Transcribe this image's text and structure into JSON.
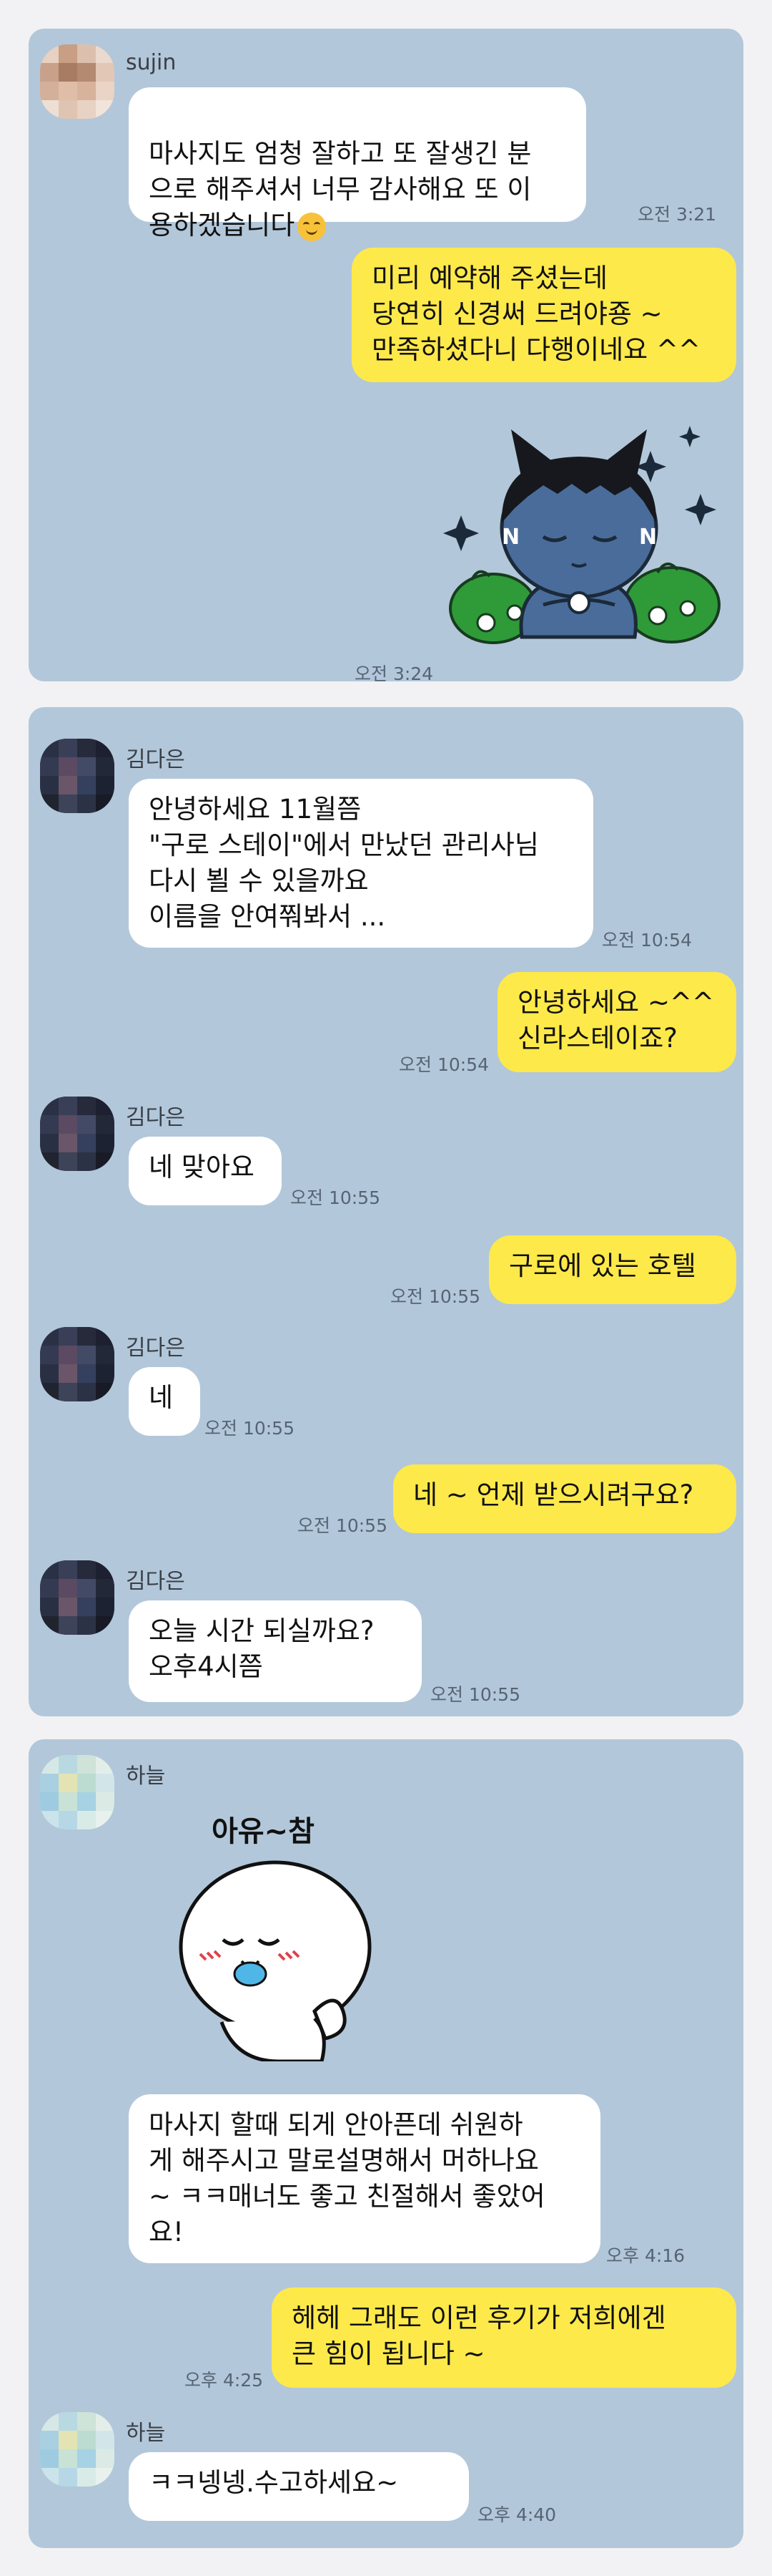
{
  "panel1": {
    "sender": "sujin",
    "msg1": "마사지도 엄청 잘하고 또 잘생긴 분\n으로 해주셔서 너무 감사해요 또 이\n용하겠습니다",
    "time1": "오전 3:21",
    "reply": "미리 예약해 주셨는데\n당연히 신경써 드려야죵 ~\n만족하셨다니 다행이네요 ^^",
    "sticker_time": "오전 3:24",
    "sticker_icon": "cat-character-sticker"
  },
  "panel2": {
    "sender": "김다은",
    "msg1": "안녕하세요 11월쯤\n\"구로 스테이\"에서 만났던 관리사님\n다시 뵐 수 있을까요\n이름을 안여쭤봐서 ...",
    "time1": "오전 10:54",
    "reply1": "안녕하세요 ~^^\n신라스테이죠?",
    "reply1_time": "오전 10:54",
    "msg2": "네 맞아요",
    "time2": "오전 10:55",
    "reply2": "구로에 있는 호텔",
    "reply2_time": "오전 10:55",
    "msg3": "네",
    "time3": "오전 10:55",
    "reply3": "네 ~ 언제 받으시려구요?",
    "reply3_time": "오전 10:55",
    "msg4": "오늘  시간 되실까요?\n오후4시쯤",
    "time4": "오전 10:55"
  },
  "panel3": {
    "sender": "하늘",
    "sticker_text": "아유~참",
    "sticker_icon": "shy-face-sticker",
    "msg1": "마사지 할때 되게 안아픈데 쉬원하\n게 해주시고 말로설명해서 머하나요\n~ ㅋㅋ매너도 좋고 친절해서 좋았어\n요!",
    "time1": "오후 4:16",
    "reply": "헤헤 그래도 이런 후기가 저희에겐\n큰 힘이 됩니다 ~",
    "reply_time": "오후 4:25",
    "sender2": "하늘",
    "msg2": "ㅋㅋ넹넹.수고하세요~",
    "time2": "오후 4:40"
  },
  "colors": {
    "chat_background": "#b2c7da",
    "incoming_bubble": "#ffffff",
    "outgoing_bubble": "#fde94a"
  }
}
